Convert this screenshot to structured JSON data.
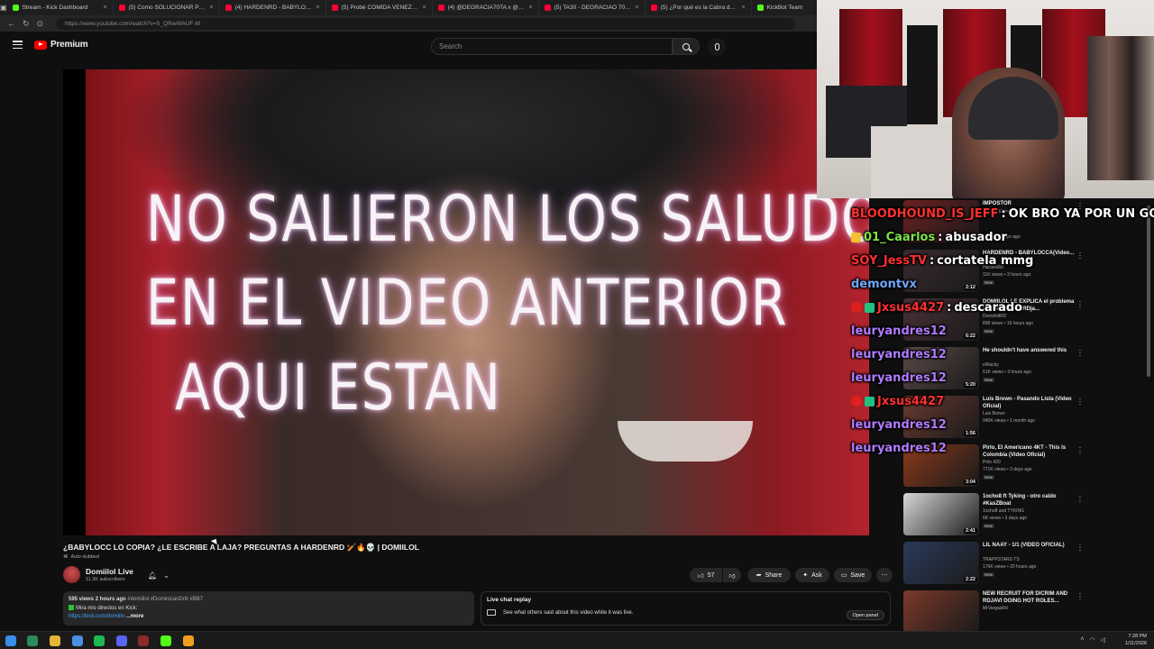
{
  "browser": {
    "tabs": [
      {
        "label": "Stream - Kick Dashboard",
        "color": "#53fc18"
      },
      {
        "label": "(5) Como SOLUCIONAR PROBL",
        "color": "#ff0033"
      },
      {
        "label": "(4) HARDENRD - BABYLOCCA",
        "color": "#ff0033"
      },
      {
        "label": "(5) Probé COMIDA VENEZOLAN",
        "color": "#ff0033"
      },
      {
        "label": "(4) @DEGRACIA70TA x @BLO",
        "color": "#ff0033"
      },
      {
        "label": "(5) TA30 - DEGRACIAO 70TA",
        "color": "#ff0033"
      },
      {
        "label": "(5) ¿Por qué es la Cabra del Dri",
        "color": "#ff0033"
      },
      {
        "label": "KickBot Team",
        "color": "#53fc18"
      }
    ],
    "close_glyph": "×",
    "url": "https://www.youtube.com/watch?v=5_QRwWAUF-M"
  },
  "youtube": {
    "logo_text": "Premium",
    "search_placeholder": "Search"
  },
  "video": {
    "overlay_lines": [
      "NO SALIERON LOS SALUDOS",
      "EN EL VIDEO ANTERIOR",
      "AQUI ESTAN"
    ],
    "title": "¿BABYLOCC LO COPIA? ¿LE ESCRIBE A LAJA? PREGUNTAS A HARDENRD 🏏🔥💀 | DOMIILOL",
    "auto_dubbed": "Auto-dubbed",
    "channel_name": "Domiilol Live",
    "subscribers": "11.3K subscribers",
    "actions": {
      "likes": "57",
      "share": "Share",
      "ask": "Ask",
      "save": "Save"
    },
    "description": {
      "meta": "595 views  2 hours ago",
      "hashtags": "#domiilol #DominicanDrill #BB7",
      "line2": "Mira mis directos en Kick:",
      "link": "https://kick.com/domiilo",
      "more": "...more"
    },
    "chat_replay": {
      "title": "Live chat replay",
      "subtitle": "See what others said about this video while it was live.",
      "button": "Open panel"
    }
  },
  "live_chat": [
    {
      "user": "BLOODHOUND_IS_JEFF",
      "message": "OK BRO YA POR UN GOL C",
      "color": "#ff3030",
      "badge": "none"
    },
    {
      "user": "01_Caarlos",
      "message": "abusador",
      "color": "#7de34a",
      "badge": "crown"
    },
    {
      "user": "SOY_JessTV",
      "message": "cortatela mmg",
      "color": "#ff3030",
      "badge": "none"
    },
    {
      "user": "demontvx",
      "message": "",
      "color": "#6fa8ff",
      "badge": "none"
    },
    {
      "user": "Jxsus4427",
      "message": "descarado",
      "color": "#ff3030",
      "badge": "mod"
    },
    {
      "user": "leuryandres12",
      "message": "",
      "color": "#b07cff",
      "badge": "none"
    },
    {
      "user": "leuryandres12",
      "message": "",
      "color": "#b07cff",
      "badge": "none"
    },
    {
      "user": "leuryandres12",
      "message": "",
      "color": "#b07cff",
      "badge": "none"
    },
    {
      "user": "Jxsus4427",
      "message": "",
      "color": "#ff3030",
      "badge": "mod"
    },
    {
      "user": "leuryandres12",
      "message": "",
      "color": "#b07cff",
      "badge": "none"
    },
    {
      "user": "leuryandres12",
      "message": "",
      "color": "#b07cff",
      "badge": "none"
    }
  ],
  "recommendations": [
    {
      "title": "IMPOSTOR",
      "subtitle": "Adivina El Impostor",
      "channel": "",
      "views": "views • 7 days ago",
      "duration": "1:11:29",
      "new": false,
      "thumb": "#6b2020"
    },
    {
      "title": "HARDENRD - BABYLOCCA(Video...",
      "subtitle": "",
      "channel": "HardenRd",
      "views": "11K views • 3 hours ago",
      "duration": "2:12",
      "new": true,
      "thumb": "#3a2a30"
    },
    {
      "title": "DOMIILOL LE EXPLICA el problema con MrStiven a RDja...",
      "subtitle": "",
      "channel": "DomiiloltRD",
      "views": "898 views • 19 hours ago",
      "duration": "6:22",
      "new": true,
      "thumb": "#4a3036"
    },
    {
      "title": "He shouldn't have answered this",
      "subtitle": "",
      "channel": "eWacky",
      "views": "51K views • 3 hours ago",
      "duration": "5:20",
      "new": true,
      "thumb": "#5a4a48"
    },
    {
      "title": "Luis Brown - Pasando Lista (Video Oficial)",
      "subtitle": "",
      "channel": "Luis Brown",
      "views": "945K views • 1 month ago",
      "duration": "1:56",
      "new": false,
      "thumb": "#6a3a30"
    },
    {
      "title": "Pirlo, El Americano 4KT - This Is Colombia (Video Oficial)",
      "subtitle": "",
      "channel": "Pirlo 420",
      "views": "771K views • 3 days ago",
      "duration": "3:04",
      "new": true,
      "thumb": "#8a3a1a"
    },
    {
      "title": "1ocho8 ft Tyking - otro caldo #KasZBoat",
      "subtitle": "",
      "channel": "1ocho8 and TYKING",
      "views": "6K views • 3 days ago",
      "duration": "2:41",
      "new": true,
      "thumb": "#d8d8d8"
    },
    {
      "title": "LIL NAAY - 1/1 (VIDEO OFICIAL)",
      "subtitle": "",
      "channel": "TRAPPSTARS TS",
      "views": "176K views • 20 hours ago",
      "duration": "2:22",
      "new": true,
      "thumb": "#2a3a5a"
    },
    {
      "title": "NEW RECRUIT FOR DICRIM AND RDJAVI DOING HOT ROLES...",
      "subtitle": "",
      "channel": "MrVargasRd",
      "views": "",
      "duration": "",
      "new": false,
      "thumb": "#7a3a2a"
    }
  ],
  "taskbar": {
    "icons": [
      {
        "name": "windows-start-icon",
        "color": "#3a8ee6"
      },
      {
        "name": "terminal-icon",
        "color": "#2a8a5a"
      },
      {
        "name": "folder-icon",
        "color": "#e6b53a"
      },
      {
        "name": "chrome-icon",
        "color": "#4a90e2"
      },
      {
        "name": "spotify-icon",
        "color": "#1db954"
      },
      {
        "name": "discord-icon",
        "color": "#5865f2"
      },
      {
        "name": "obs-icon",
        "color": "#8a2a2a"
      },
      {
        "name": "kick-icon",
        "color": "#53fc18"
      },
      {
        "name": "chrome-alt-icon",
        "color": "#f0a020"
      }
    ],
    "time": "7:28 PM",
    "date": "1/11/2026"
  }
}
